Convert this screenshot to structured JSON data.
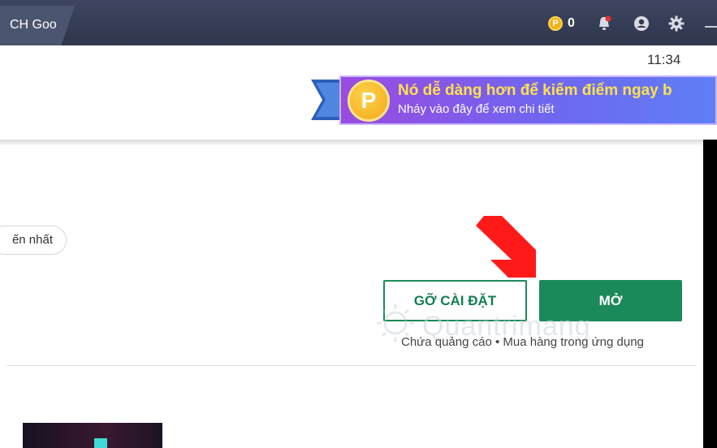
{
  "window": {
    "tab_title": "CH Goo",
    "coin_count": "0"
  },
  "status_bar": {
    "time": "11:34"
  },
  "banner": {
    "coin_symbol": "P",
    "title": "Nó dễ dàng hơn để kiếm điểm ngay b",
    "subtitle": "Nháy vào đây để xem chi tiết"
  },
  "chip": {
    "label": "ến nhất"
  },
  "actions": {
    "uninstall_label": "GỠ CÀI ĐẶT",
    "open_label": "MỞ"
  },
  "app_info": {
    "ads_note": "Chứa quảng cáo • Mua hàng trong ứng dụng"
  },
  "watermark": {
    "text": "Quantrimang"
  },
  "colors": {
    "topbar": "#2f364d",
    "primary_green": "#1b8a5a",
    "banner_title": "#ffe14d",
    "arrow": "#ff0000"
  },
  "icons": [
    "coin-icon",
    "bell-icon",
    "user-icon",
    "gear-icon",
    "minimize-icon"
  ]
}
